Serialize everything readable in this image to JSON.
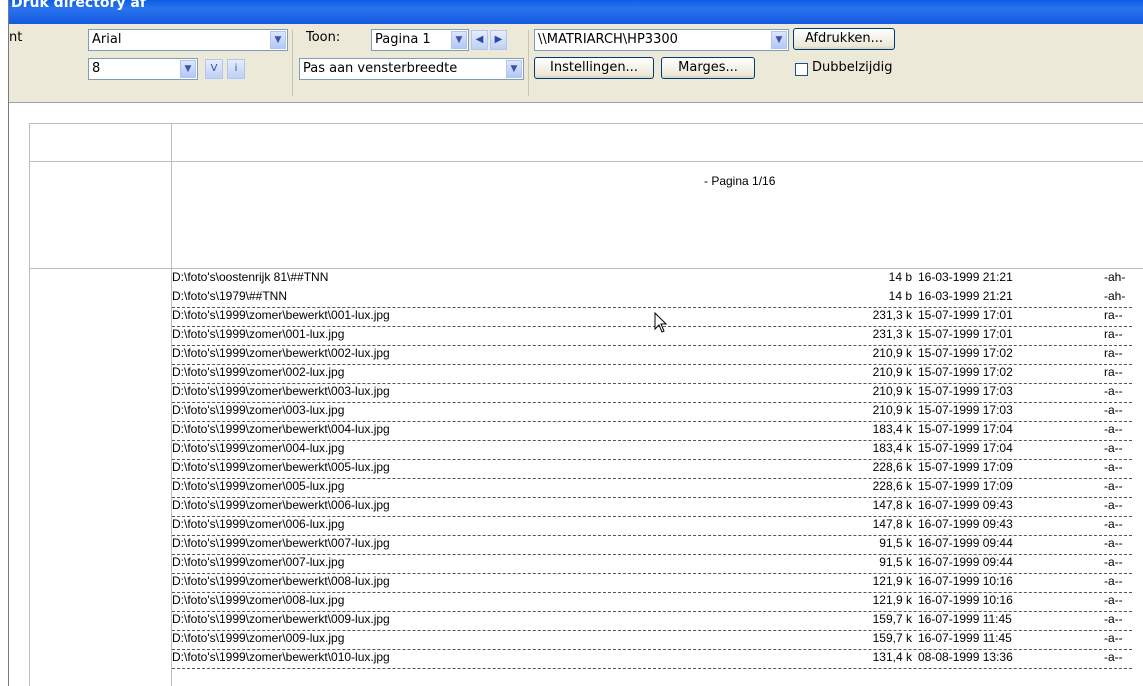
{
  "window": {
    "title": "Druk directory af"
  },
  "toolbar": {
    "font_label": "nt",
    "font_name": "Arial",
    "font_size": "8",
    "bold_btn": "V",
    "italic_btn": "i",
    "toon_label": "Toon:",
    "page_select": "Pagina 1",
    "fit_select": "Pas aan vensterbreedte",
    "printer_select": "\\\\MATRIARCH\\HP3300",
    "print_btn": "Afdrukken...",
    "settings_btn": "Instellingen...",
    "margins_btn": "Marges...",
    "duplex_label": "Dubbelzijdig",
    "duplex_checked": false
  },
  "preview": {
    "page_label": "- Pagina 1/16",
    "rows": [
      {
        "path": "D:\\foto's\\oostenrijk 81\\##TNN",
        "size": "14 b",
        "date": "16-03-1999 21:21",
        "attr": "-ah-",
        "dashed": false
      },
      {
        "path": "D:\\foto's\\1979\\##TNN",
        "size": "14 b",
        "date": "16-03-1999 21:21",
        "attr": "-ah-",
        "dashed": true
      },
      {
        "path": "D:\\foto's\\1999\\zomer\\bewerkt\\001-lux.jpg",
        "size": "231,3 k",
        "date": "15-07-1999 17:01",
        "attr": "ra--",
        "dashed": true
      },
      {
        "path": "D:\\foto's\\1999\\zomer\\001-lux.jpg",
        "size": "231,3 k",
        "date": "15-07-1999 17:01",
        "attr": "ra--",
        "dashed": true
      },
      {
        "path": "D:\\foto's\\1999\\zomer\\bewerkt\\002-lux.jpg",
        "size": "210,9 k",
        "date": "15-07-1999 17:02",
        "attr": "ra--",
        "dashed": true
      },
      {
        "path": "D:\\foto's\\1999\\zomer\\002-lux.jpg",
        "size": "210,9 k",
        "date": "15-07-1999 17:02",
        "attr": "ra--",
        "dashed": true
      },
      {
        "path": "D:\\foto's\\1999\\zomer\\bewerkt\\003-lux.jpg",
        "size": "210,9 k",
        "date": "15-07-1999 17:03",
        "attr": "-a--",
        "dashed": true
      },
      {
        "path": "D:\\foto's\\1999\\zomer\\003-lux.jpg",
        "size": "210,9 k",
        "date": "15-07-1999 17:03",
        "attr": "-a--",
        "dashed": true
      },
      {
        "path": "D:\\foto's\\1999\\zomer\\bewerkt\\004-lux.jpg",
        "size": "183,4 k",
        "date": "15-07-1999 17:04",
        "attr": "-a--",
        "dashed": true
      },
      {
        "path": "D:\\foto's\\1999\\zomer\\004-lux.jpg",
        "size": "183,4 k",
        "date": "15-07-1999 17:04",
        "attr": "-a--",
        "dashed": true
      },
      {
        "path": "D:\\foto's\\1999\\zomer\\bewerkt\\005-lux.jpg",
        "size": "228,6 k",
        "date": "15-07-1999 17:09",
        "attr": "-a--",
        "dashed": true
      },
      {
        "path": "D:\\foto's\\1999\\zomer\\005-lux.jpg",
        "size": "228,6 k",
        "date": "15-07-1999 17:09",
        "attr": "-a--",
        "dashed": true
      },
      {
        "path": "D:\\foto's\\1999\\zomer\\bewerkt\\006-lux.jpg",
        "size": "147,8 k",
        "date": "16-07-1999 09:43",
        "attr": "-a--",
        "dashed": true
      },
      {
        "path": "D:\\foto's\\1999\\zomer\\006-lux.jpg",
        "size": "147,8 k",
        "date": "16-07-1999 09:43",
        "attr": "-a--",
        "dashed": true
      },
      {
        "path": "D:\\foto's\\1999\\zomer\\bewerkt\\007-lux.jpg",
        "size": "91,5 k",
        "date": "16-07-1999 09:44",
        "attr": "-a--",
        "dashed": true
      },
      {
        "path": "D:\\foto's\\1999\\zomer\\007-lux.jpg",
        "size": "91,5 k",
        "date": "16-07-1999 09:44",
        "attr": "-a--",
        "dashed": true
      },
      {
        "path": "D:\\foto's\\1999\\zomer\\bewerkt\\008-lux.jpg",
        "size": "121,9 k",
        "date": "16-07-1999 10:16",
        "attr": "-a--",
        "dashed": true
      },
      {
        "path": "D:\\foto's\\1999\\zomer\\008-lux.jpg",
        "size": "121,9 k",
        "date": "16-07-1999 10:16",
        "attr": "-a--",
        "dashed": true
      },
      {
        "path": "D:\\foto's\\1999\\zomer\\bewerkt\\009-lux.jpg",
        "size": "159,7 k",
        "date": "16-07-1999 11:45",
        "attr": "-a--",
        "dashed": true
      },
      {
        "path": "D:\\foto's\\1999\\zomer\\009-lux.jpg",
        "size": "159,7 k",
        "date": "16-07-1999 11:45",
        "attr": "-a--",
        "dashed": true
      },
      {
        "path": "D:\\foto's\\1999\\zomer\\bewerkt\\010-lux.jpg",
        "size": "131,4 k",
        "date": "08-08-1999 13:36",
        "attr": "-a--",
        "dashed": true
      }
    ]
  },
  "colors": {
    "titlebar": "#1559e0",
    "toolbar_bg": "#ece9d8",
    "input_border": "#7f9db9"
  }
}
